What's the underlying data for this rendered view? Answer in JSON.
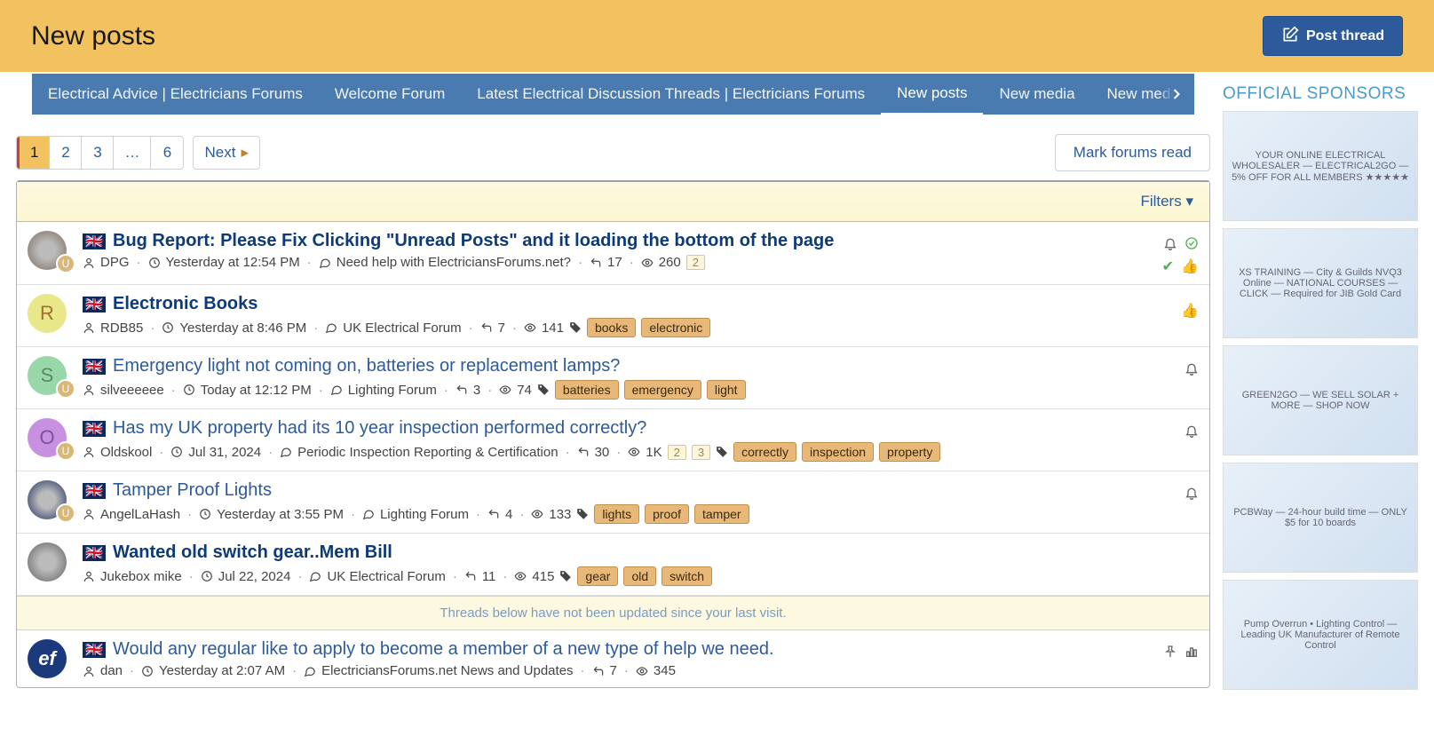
{
  "header": {
    "title": "New posts",
    "post_button": "Post thread"
  },
  "nav": {
    "items": [
      "Electrical Advice | Electricians Forums",
      "Welcome Forum",
      "Latest Electrical Discussion Threads | Electricians Forums",
      "New posts",
      "New media",
      "New medi"
    ],
    "active_index": 3
  },
  "pager": {
    "pages": [
      "1",
      "2",
      "3",
      "…",
      "6"
    ],
    "current": 0,
    "next": "Next"
  },
  "actions": {
    "mark_read": "Mark forums read",
    "filters": "Filters"
  },
  "separator": "Threads below have not been updated since your last visit.",
  "sidebar": {
    "title": "OFFICIAL SPONSORS",
    "ads": [
      "YOUR ONLINE ELECTRICAL WHOLESALER — ELECTRICAL2GO — 5% OFF FOR ALL MEMBERS ★★★★★",
      "XS TRAINING — City & Guilds NVQ3 Online — NATIONAL COURSES — CLICK — Required for JIB Gold Card",
      "GREEN2GO — WE SELL SOLAR + MORE — SHOP NOW",
      "PCBWay — 24-hour build time — ONLY $5 for 10 boards",
      "Pump Overrun • Lighting Control — Leading UK Manufacturer of Remote Control"
    ]
  },
  "threads": [
    {
      "avatar": {
        "type": "img",
        "bg": "#7a6a5a",
        "text": ""
      },
      "sub": "U",
      "title": "Bug Report: Please Fix Clicking \"Unread Posts\" and it loading the bottom of the page",
      "unread": true,
      "author": "DPG",
      "time": "Yesterday at 12:54 PM",
      "forum": "Need help with ElectriciansForums.net?",
      "replies": "17",
      "views": "260",
      "page_inds": [
        "2"
      ],
      "tags": [],
      "top_icons": [
        "bell",
        "check-circle"
      ],
      "bot_icons": [
        "tick",
        "thumb"
      ]
    },
    {
      "avatar": {
        "type": "letter",
        "bg": "#e8e88a",
        "text": "R",
        "fg": "#a07030"
      },
      "sub": null,
      "title": "Electronic Books",
      "unread": true,
      "author": "RDB85",
      "time": "Yesterday at 8:46 PM",
      "forum": "UK Electrical Forum",
      "replies": "7",
      "views": "141",
      "page_inds": [],
      "tags": [
        "books",
        "electronic"
      ],
      "top_icons": [],
      "bot_icons": [
        "thumb"
      ]
    },
    {
      "avatar": {
        "type": "letter",
        "bg": "#98d8a8",
        "text": "S",
        "fg": "#5a8a60"
      },
      "sub": "U",
      "title": "Emergency light not coming on, batteries or replacement lamps?",
      "unread": false,
      "author": "silveeeeee",
      "time": "Today at 12:12 PM",
      "forum": "Lighting Forum",
      "replies": "3",
      "views": "74",
      "page_inds": [],
      "tags": [
        "batteries",
        "emergency",
        "light"
      ],
      "top_icons": [
        "bell"
      ],
      "bot_icons": []
    },
    {
      "avatar": {
        "type": "letter",
        "bg": "#c890e0",
        "text": "O",
        "fg": "#7a50a0"
      },
      "sub": "U",
      "title": "Has my UK property had its 10 year inspection performed correctly?",
      "unread": false,
      "author": "Oldskool",
      "time": "Jul 31, 2024",
      "forum": "Periodic Inspection Reporting & Certification",
      "replies": "30",
      "views": "1K",
      "page_inds": [
        "2",
        "3"
      ],
      "tags": [
        "correctly",
        "inspection",
        "property"
      ],
      "top_icons": [
        "bell"
      ],
      "bot_icons": []
    },
    {
      "avatar": {
        "type": "img",
        "bg": "#1a2a5c",
        "text": ""
      },
      "sub": "U",
      "title": "Tamper Proof Lights",
      "unread": false,
      "author": "AngelLaHash",
      "time": "Yesterday at 3:55 PM",
      "forum": "Lighting Forum",
      "replies": "4",
      "views": "133",
      "page_inds": [],
      "tags": [
        "lights",
        "proof",
        "tamper"
      ],
      "top_icons": [
        "bell"
      ],
      "bot_icons": []
    },
    {
      "avatar": {
        "type": "img",
        "bg": "#606060",
        "text": ""
      },
      "sub": null,
      "title": "Wanted old switch gear..Mem Bill",
      "unread": true,
      "author": "Jukebox mike",
      "time": "Jul 22, 2024",
      "forum": "UK Electrical Forum",
      "replies": "11",
      "views": "415",
      "page_inds": [],
      "tags": [
        "gear",
        "old",
        "switch"
      ],
      "top_icons": [],
      "bot_icons": []
    },
    {
      "separator_before": true,
      "avatar": {
        "type": "logo",
        "bg": "#1a3a7c",
        "text": "ef",
        "fg": "#fff"
      },
      "sub": null,
      "title": "Would any regular like to apply to become a member of a new type of help we need.",
      "unread": false,
      "author": "dan",
      "time": "Yesterday at 2:07 AM",
      "forum": "ElectriciansForums.net News and Updates",
      "replies": "7",
      "views": "345",
      "page_inds": [],
      "tags": [],
      "top_icons": [
        "pin",
        "poll"
      ],
      "bot_icons": []
    }
  ]
}
